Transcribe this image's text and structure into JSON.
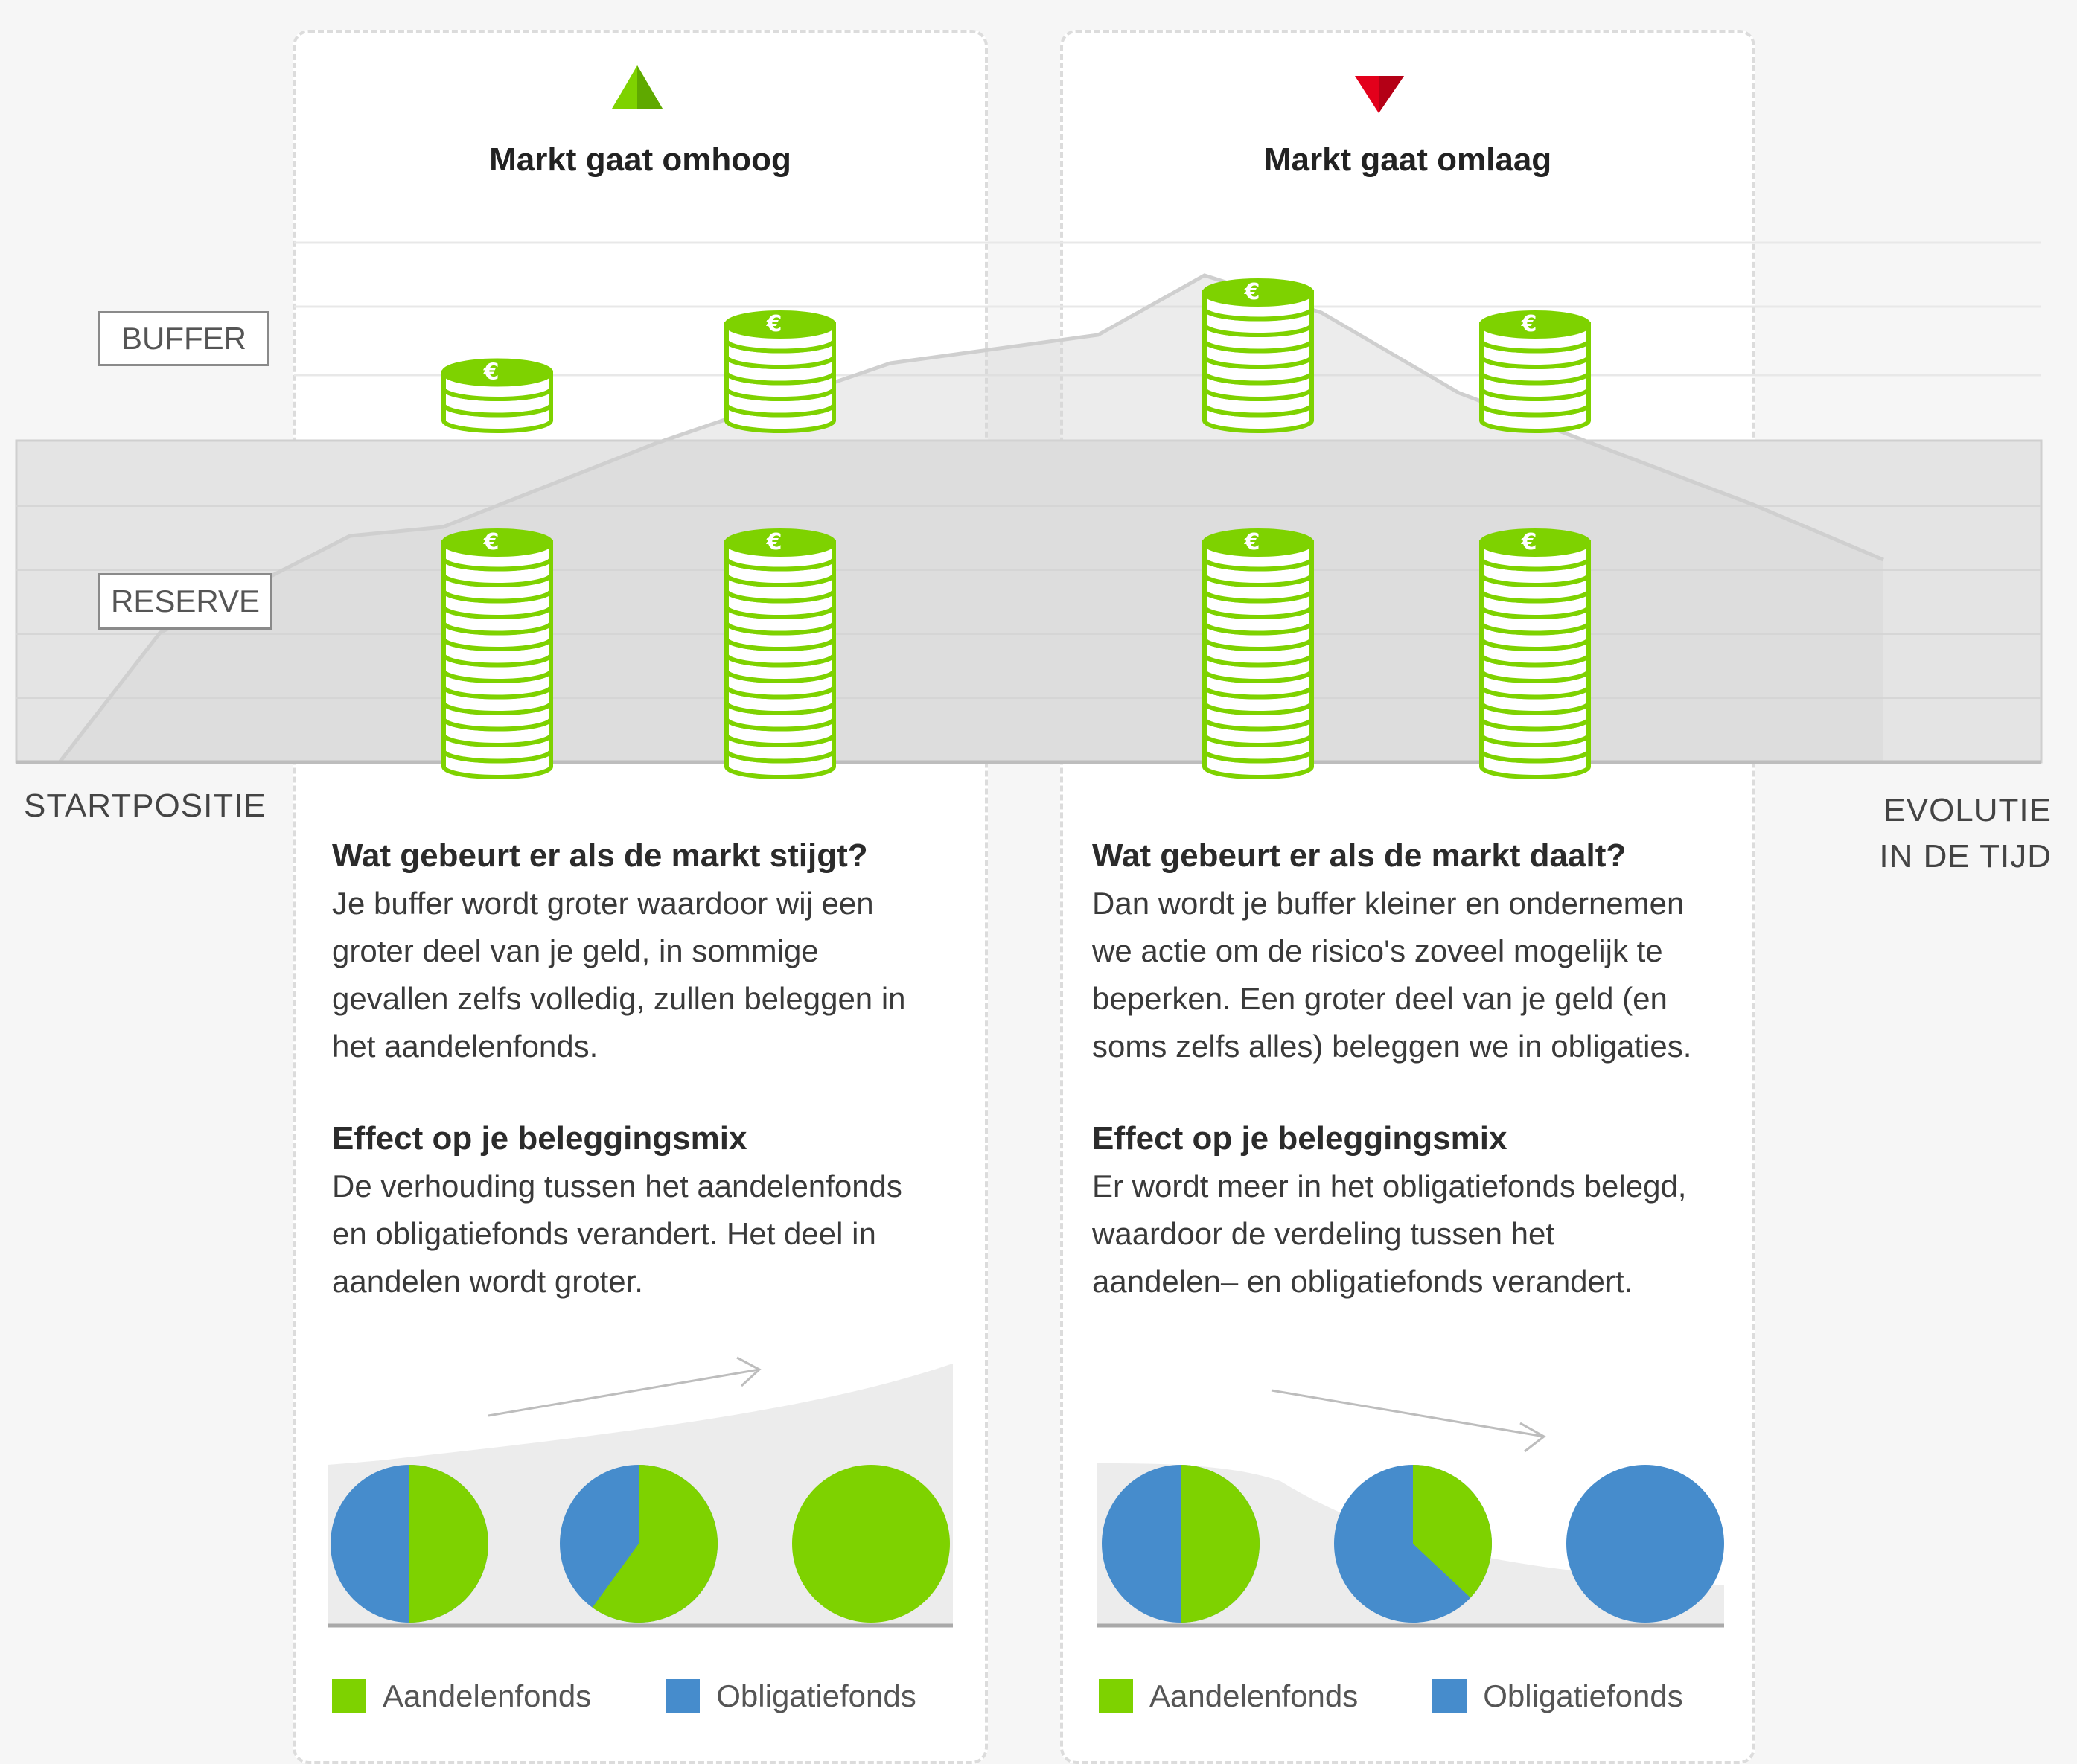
{
  "labels": {
    "buffer": "BUFFER",
    "reserve": "RESERVE",
    "start": "STARTPOSITIE",
    "evolution_line1": "EVOLUTIE",
    "evolution_line2": "IN DE TIJD"
  },
  "colors": {
    "green": "#7ed200",
    "blue": "#468ccc",
    "red": "#e3001b",
    "line": "#cfcfcf"
  },
  "up": {
    "title": "Markt gaat omhoog",
    "indicator_icon": "triangle-up-icon",
    "question": "Wat gebeurt er als de markt stijgt?",
    "answer": "Je buffer wordt groter waardoor wij een groter deel van je geld, in sommige gevallen zelfs volledig, zullen beleggen in het aandelenfonds.",
    "effect_title": "Effect op je beleggingsmix",
    "effect_text": "De verhouding tussen het aandelenfonds en obligatiefonds verandert. Het deel in aandelen wordt groter.",
    "pie_equity_shares": [
      0.5,
      0.6,
      1.0
    ]
  },
  "down": {
    "title": "Markt gaat omlaag",
    "indicator_icon": "triangle-down-icon",
    "question": "Wat gebeurt er als de markt daalt?",
    "answer": "Dan wordt je buffer kleiner en ondernemen we actie om de risico's zoveel mogelijk te beperken. Een groter deel van je geld (en soms zelfs alles) beleggen we in obligaties.",
    "effect_title": "Effect op je beleggingsmix",
    "effect_text": "Er wordt meer in het obligatiefonds belegd, waardoor de verdeling tussen het aandelen– en obligatiefonds verandert.",
    "pie_equity_shares": [
      0.5,
      0.37,
      0.0
    ]
  },
  "legend": {
    "equity": "Aandelenfonds",
    "bonds": "Obligatiefonds"
  },
  "coin_stacks": {
    "reserve_counts": [
      14,
      14,
      14,
      14
    ],
    "buffer_counts": [
      3,
      6,
      8,
      6
    ]
  }
}
